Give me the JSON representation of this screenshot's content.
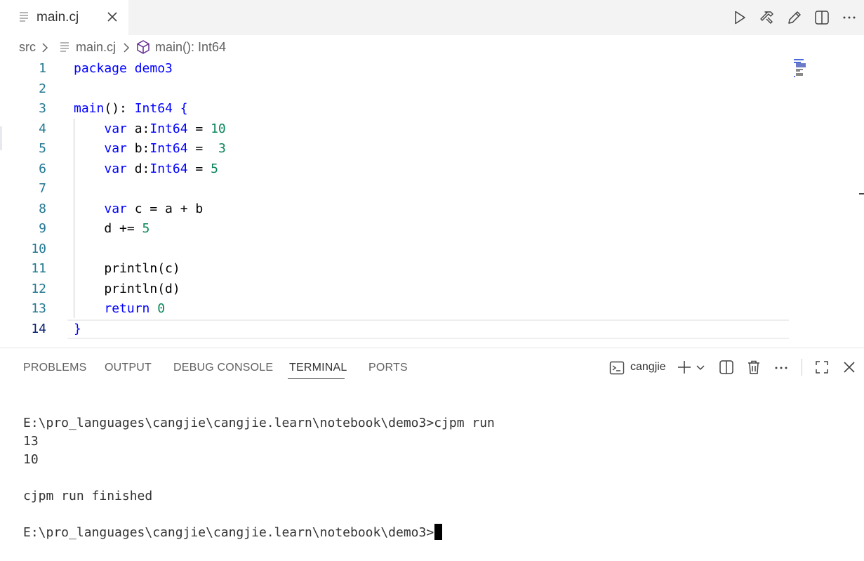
{
  "tab": {
    "label": "main.cj"
  },
  "editor_actions": [
    "run-icon",
    "build-icon",
    "edit-icon",
    "split-editor-icon",
    "more-icon"
  ],
  "breadcrumb": {
    "folder": "src",
    "file": "main.cj",
    "symbol": "main(): Int64"
  },
  "code": {
    "line_numbers": [
      "1",
      "2",
      "3",
      "4",
      "5",
      "6",
      "7",
      "8",
      "9",
      "10",
      "11",
      "12",
      "13",
      "14"
    ],
    "active_line": "14"
  },
  "panel": {
    "tabs": [
      "PROBLEMS",
      "OUTPUT",
      "DEBUG CONSOLE",
      "TERMINAL",
      "PORTS"
    ],
    "active_tab": "TERMINAL",
    "terminal_name": "cangjie"
  },
  "terminal": {
    "lines": [
      "E:\\pro_languages\\cangjie\\cangjie.learn\\notebook\\demo3>cjpm run",
      "13",
      "10",
      "",
      "cjpm run finished",
      "",
      "E:\\pro_languages\\cangjie\\cangjie.learn\\notebook\\demo3>"
    ]
  },
  "colors": {
    "keyword": "#0000ff",
    "number": "#098658",
    "line_number": "#237893",
    "tabbar_bg": "#f3f3f3"
  }
}
